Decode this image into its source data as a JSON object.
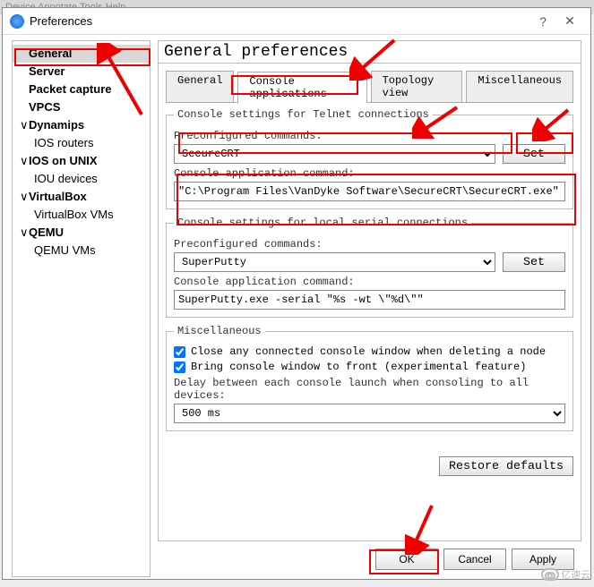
{
  "menubar": "Device   Annotate   Tools   Help",
  "window": {
    "title": "Preferences",
    "help": "?",
    "close": "✕"
  },
  "sidebar": {
    "items": [
      {
        "label": "General",
        "sel": true
      },
      {
        "label": "Server"
      },
      {
        "label": "Packet capture"
      },
      {
        "label": "VPCS"
      },
      {
        "label": "Dynamips",
        "exp": true
      },
      {
        "label": "IOS routers",
        "child": true
      },
      {
        "label": "IOS on UNIX",
        "exp": true
      },
      {
        "label": "IOU devices",
        "child": true
      },
      {
        "label": "VirtualBox",
        "exp": true
      },
      {
        "label": "VirtualBox VMs",
        "child": true
      },
      {
        "label": "QEMU",
        "exp": true
      },
      {
        "label": "QEMU VMs",
        "child": true
      }
    ]
  },
  "header": "General preferences",
  "tabs": [
    "General",
    "Console applications",
    "Topology view",
    "Miscellaneous"
  ],
  "active_tab": 1,
  "telnet_group": {
    "legend": "Console settings for Telnet connections",
    "pre_label": "Preconfigured commands:",
    "pre_value": "SecureCRT",
    "set": "Set",
    "cmd_label": "Console application command:",
    "cmd_value": "\"C:\\Program Files\\VanDyke Software\\SecureCRT\\SecureCRT.exe\" /SCRIPT"
  },
  "serial_group": {
    "legend": "Console settings for local serial connections",
    "pre_label": "Preconfigured commands:",
    "pre_value": "SuperPutty",
    "set": "Set",
    "cmd_label": "Console application command:",
    "cmd_value": "SuperPutty.exe -serial \"%s -wt \\\"%d\\\"\""
  },
  "misc_group": {
    "legend": "Miscellaneous",
    "chk1": "Close any connected console window when deleting a node",
    "chk2": "Bring console window to front (experimental feature)",
    "delay_label": "Delay between each console launch when consoling to all devices:",
    "delay_value": "500 ms"
  },
  "restore": "Restore defaults",
  "buttons": {
    "ok": "OK",
    "cancel": "Cancel",
    "apply": "Apply"
  },
  "watermark": "亿速云"
}
